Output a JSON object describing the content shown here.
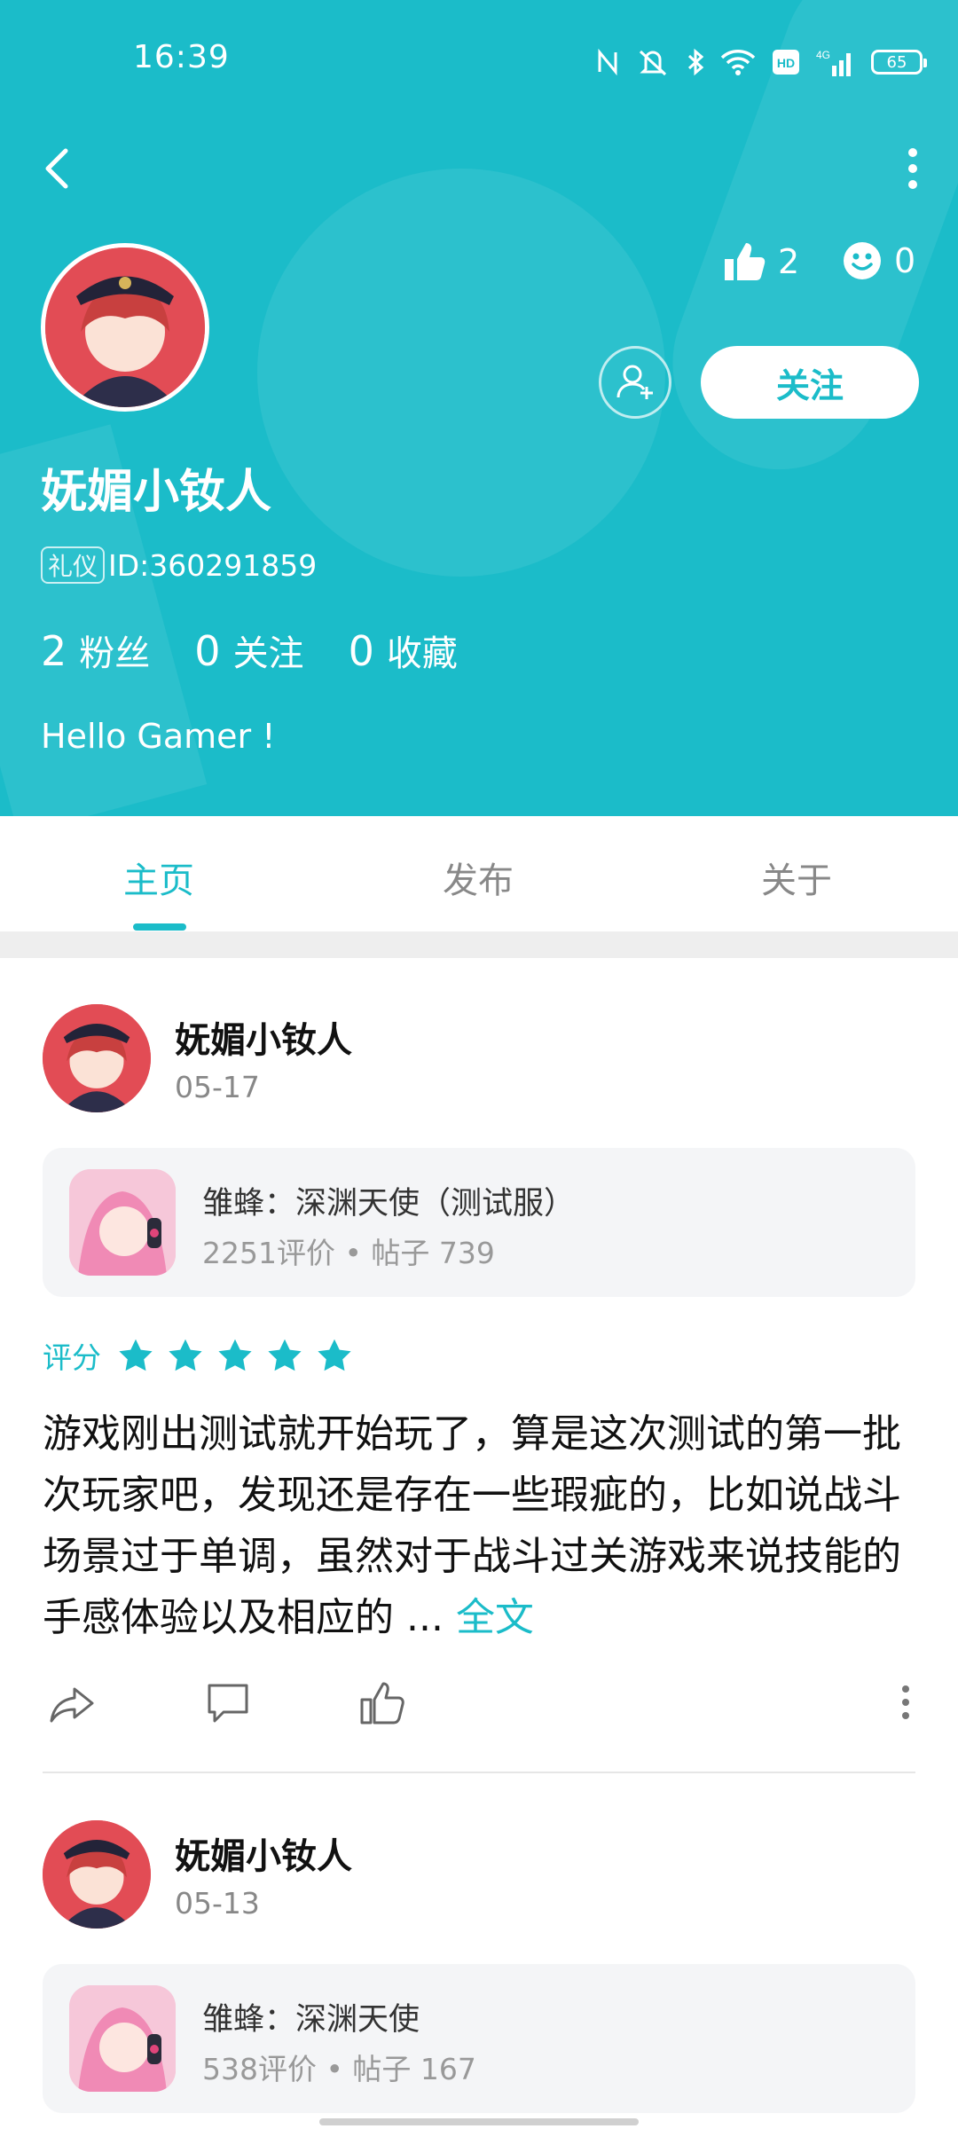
{
  "status_bar": {
    "time": "16:39",
    "battery": "65"
  },
  "profile": {
    "name": "妩媚小钕人",
    "badge": "礼仪",
    "id_text": "ID:360291859",
    "likes": "2",
    "smiles": "0",
    "follow_label": "关注",
    "stats": [
      {
        "num": "2",
        "label": "粉丝"
      },
      {
        "num": "0",
        "label": "关注"
      },
      {
        "num": "0",
        "label": "收藏"
      }
    ],
    "bio": "Hello Gamer !"
  },
  "tabs": [
    {
      "label": "主页",
      "active": true
    },
    {
      "label": "发布",
      "active": false
    },
    {
      "label": "关于",
      "active": false
    }
  ],
  "posts": [
    {
      "author": "妩媚小钕人",
      "date": "05-17",
      "game_title": "雏蜂：深渊天使（测试服）",
      "game_meta": "2251评价 • 帖子 739",
      "rating_label": "评分",
      "rating": 5,
      "text": "游戏刚出测试就开始玩了，算是这次测试的第一批次玩家吧，发现还是存在一些瑕疵的，比如说战斗场景过于单调，虽然对于战斗过关游戏来说技能的手感体验以及相应的 ... ",
      "more_label": "全文"
    },
    {
      "author": "妩媚小钕人",
      "date": "05-13",
      "game_title": "雏蜂：深渊天使",
      "game_meta": "538评价 • 帖子 167"
    }
  ],
  "colors": {
    "accent": "#1bbcc9",
    "header_bg": "#1bbcc9"
  }
}
